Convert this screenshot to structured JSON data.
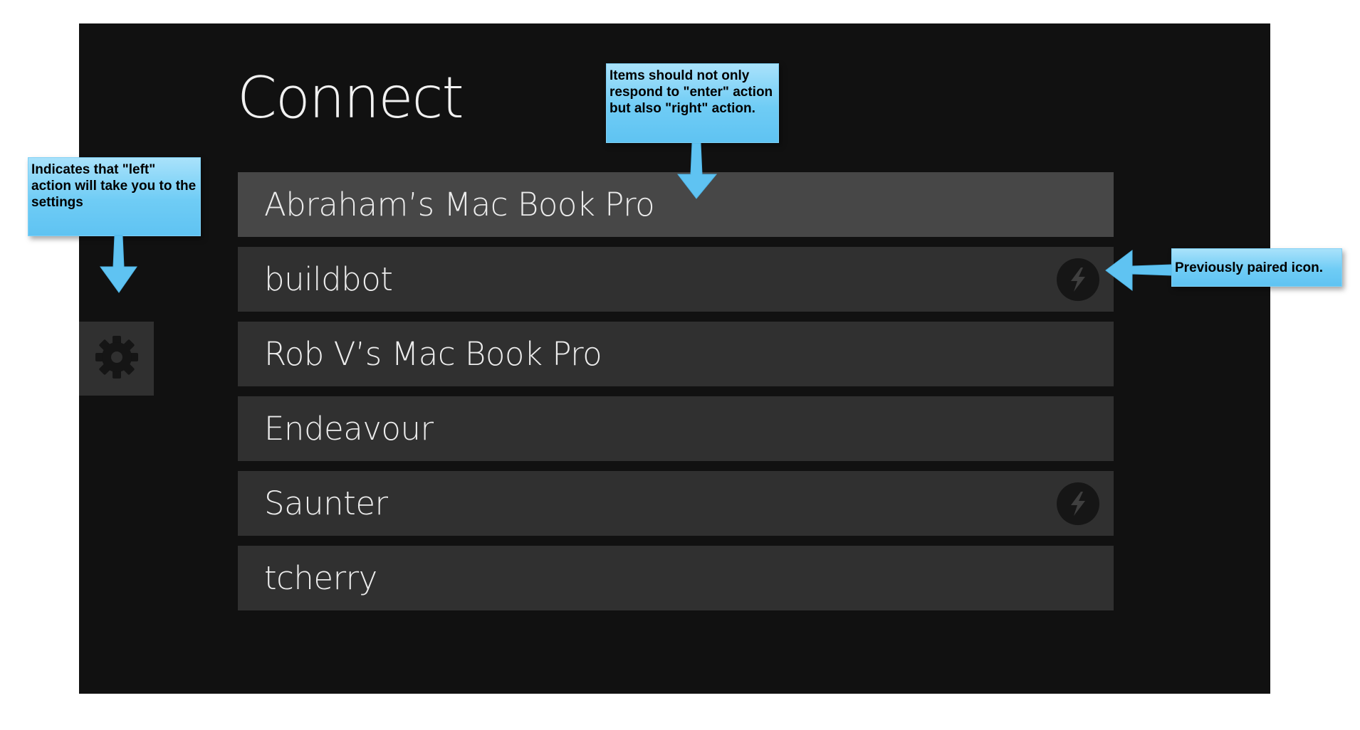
{
  "screen": {
    "title": "Connect",
    "settings": {
      "icon": "gear-icon"
    },
    "devices": [
      {
        "label": "Abraham’s Mac Book Pro",
        "selected": true,
        "previously_paired": false
      },
      {
        "label": "buildbot",
        "selected": false,
        "previously_paired": true
      },
      {
        "label": "Rob V’s Mac Book Pro",
        "selected": false,
        "previously_paired": false
      },
      {
        "label": "Endeavour",
        "selected": false,
        "previously_paired": false
      },
      {
        "label": "Saunter",
        "selected": false,
        "previously_paired": true
      },
      {
        "label": "tcherry",
        "selected": false,
        "previously_paired": false
      }
    ],
    "paired_icon": "lightning-bolt-icon"
  },
  "annotations": {
    "settings_note": "Indicates that \"left\" action will take you to the settings",
    "items_note": "Items should not only respond to \"enter\" action but also \"right\" action.",
    "paired_note": "Previously paired icon."
  },
  "colors": {
    "background": "#111111",
    "item": "#303030",
    "item_selected": "#474747",
    "callout": "#6fccf5",
    "arrow": "#5fc3f2"
  }
}
